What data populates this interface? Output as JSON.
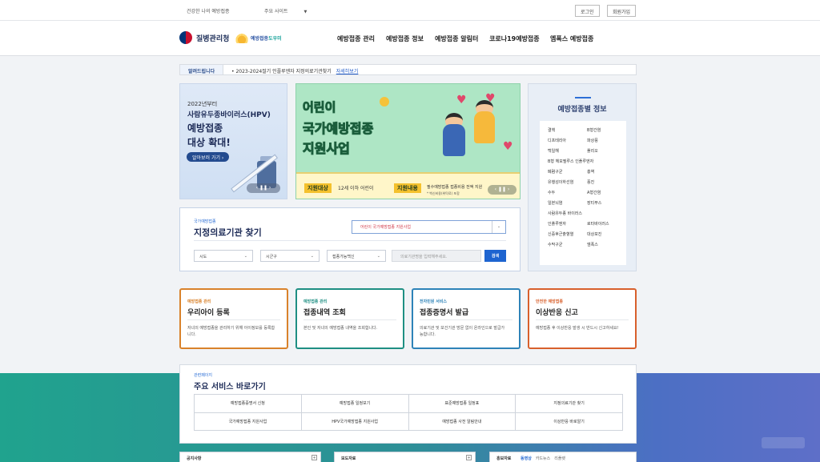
{
  "topbar": {
    "link": "건강한 나의 예방접종",
    "site_select": "주요 사이트",
    "login": "로그인",
    "join": "회원가입"
  },
  "header": {
    "org_name": "질병관리청",
    "site_logo_main": "예방접종",
    "site_logo_sub": "도우미",
    "nav": [
      "예방접종 관리",
      "예방접종 정보",
      "예방접종 알림터",
      "코로나19예방접종",
      "엠폭스 예방접종"
    ]
  },
  "notice": {
    "label": "알려드립니다",
    "text": "• 2023-2024절기 인플루엔자 지정의료기관찾기",
    "more": "자세히보기"
  },
  "hpv_banner": {
    "line1": "2022년부터",
    "line2": "사람유두종바이러스(HPV)",
    "line3": "예방접종",
    "line4": "대상 확대!",
    "button": "알아보러 가기 ›",
    "control": "‹ ❚❚ ›"
  },
  "main_banner": {
    "title1": "어린이",
    "title2": "국가예방접종",
    "title3": "지원사업",
    "tag1": "지원대상",
    "tag1_text": "12세 이하 어린이",
    "tag2": "지원내용",
    "tag2_text": "필수예방접종 접종비용 전액 지원",
    "note": "* 백신비용(위탁료) 포함",
    "control": "‹ ❚❚ ›"
  },
  "vaccine_info": {
    "title": "예방접종별 정보",
    "rows": [
      [
        "결핵",
        "B형간염"
      ],
      [
        "디프테리아",
        "파상풍"
      ],
      [
        "백일해",
        "폴리오"
      ],
      [
        "B형 헤모필루스 인플루엔자",
        ""
      ],
      [
        "폐렴구균",
        "홍역"
      ],
      [
        "유행성이하선염",
        "풍진"
      ],
      [
        "수두",
        "A형간염"
      ],
      [
        "일본뇌염",
        "장티푸스"
      ],
      [
        "사람유두종 바이러스",
        ""
      ],
      [
        "인플루엔자",
        "로타바이러스"
      ],
      [
        "신증후군출혈열",
        "대상포진"
      ],
      [
        "수막구균",
        "엠폭스"
      ]
    ]
  },
  "clinic_search": {
    "label": "국가예방접종",
    "title": "지정의료기관 찾기",
    "program_select": "어린이 국가예방접종 지원사업",
    "sido": "시도",
    "sigungu": "시군구",
    "vaccine": "접종가능백신",
    "input_placeholder": "의료기관명을 입력해주세요.",
    "search_button": "검색"
  },
  "cards": [
    {
      "category": "예방접종 관리",
      "title": "우리아이 등록",
      "desc": "자녀의 예방접종을 관리하기 위해 아이정보를 등록합니다.",
      "color": "#d9822b"
    },
    {
      "category": "예방접종 관리",
      "title": "접종내역 조회",
      "desc": "본인 및 자녀의 예방접종 내역을 조회합니다.",
      "color": "#1f8f83"
    },
    {
      "category": "전자민원 서비스",
      "title": "접종증명서 발급",
      "desc": "의료기관 및 보건기관 방문 없이 온라인으로 발급가능합니다.",
      "color": "#2e83b8"
    },
    {
      "category": "안전한 예방접종",
      "title": "이상반응 신고",
      "desc": "예방접종 후 이상반응 발생 시 반드시 신고하세요!",
      "color": "#d8602c"
    }
  ],
  "shortcuts": {
    "label": "관련페이지",
    "title": "주요 서비스 바로가기",
    "items": [
      "예방접종증명서 신청",
      "예방접종 일정보기",
      "표준예방접종 일정표",
      "지정의료기관 찾기",
      "국가예방접종 지원사업",
      "HPV국가예방접종 지원사업",
      "예방접종 사전 알림안내",
      "이상반응 바로알기"
    ]
  },
  "boards": {
    "notice": "공지사항",
    "press": "보도자료",
    "pr": "홍보자료",
    "tabs": [
      "동영상",
      "카드뉴스",
      "리플렛"
    ],
    "plus": "+"
  }
}
